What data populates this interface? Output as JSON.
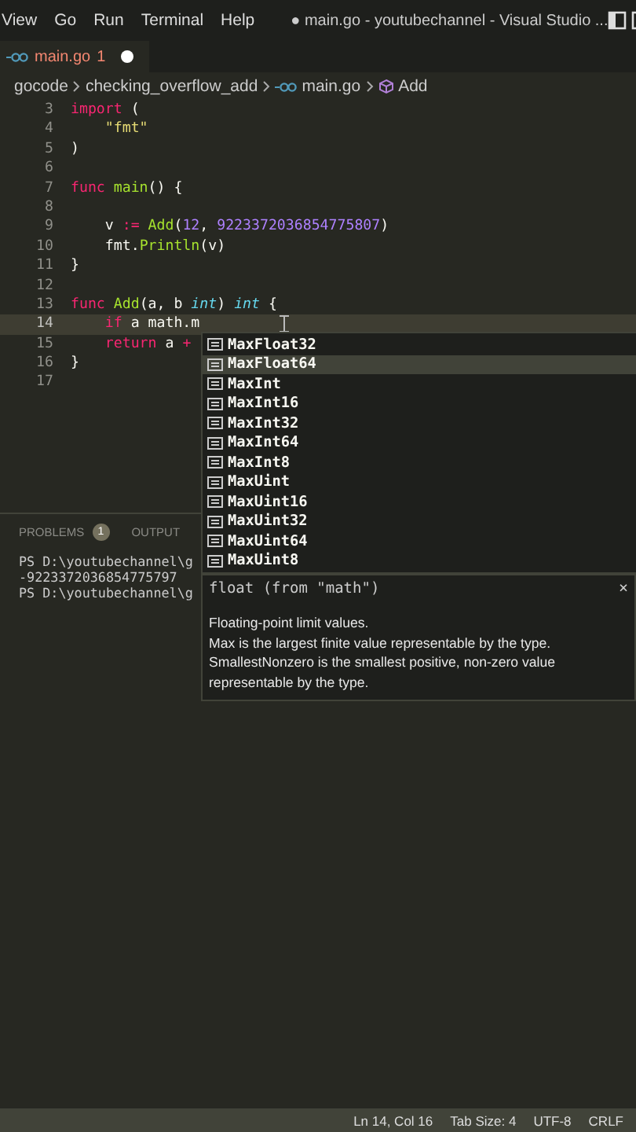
{
  "menu": [
    "View",
    "Go",
    "Run",
    "Terminal",
    "Help"
  ],
  "window": {
    "title": "● main.go - youtubechannel - Visual Studio ..."
  },
  "tabs": [
    {
      "label": "main.go",
      "problems": "1",
      "dirty": true,
      "selected": true
    }
  ],
  "breadcrumb": [
    {
      "text": "gocode",
      "kind": "folder"
    },
    {
      "text": "checking_overflow_add",
      "kind": "folder"
    },
    {
      "text": "main.go",
      "kind": "gofile"
    },
    {
      "text": "Add",
      "kind": "function"
    }
  ],
  "lines": [
    {
      "number": "3",
      "current": false,
      "tokens": [
        {
          "text": "import",
          "kind": "keyword"
        },
        {
          "text": " (",
          "kind": "paren"
        }
      ]
    },
    {
      "number": "4",
      "current": false,
      "tokens": [
        {
          "text": "    \"fmt\"",
          "kind": "string"
        }
      ]
    },
    {
      "number": "5",
      "current": false,
      "tokens": [
        {
          "text": ")",
          "kind": "paren"
        }
      ]
    },
    {
      "number": "6",
      "current": false
    },
    {
      "number": "7",
      "current": false,
      "tokens": [
        {
          "text": "func",
          "kind": "keyword"
        },
        {
          "text": " main",
          "kind": "function"
        },
        {
          "text": "() {",
          "kind": "paren"
        }
      ]
    },
    {
      "number": "8",
      "current": false
    },
    {
      "number": "9",
      "current": false,
      "tokens": [
        {
          "text": "    v ",
          "kind": "plain"
        },
        {
          "text": ":=",
          "kind": "keyword"
        },
        {
          "text": " Add",
          "kind": "function"
        },
        {
          "text": "(",
          "kind": "paren"
        },
        {
          "text": "12",
          "kind": "number"
        },
        {
          "text": ", ",
          "kind": "plain"
        },
        {
          "text": "9223372036854775807",
          "kind": "number"
        },
        {
          "text": ")",
          "kind": "paren"
        }
      ]
    },
    {
      "number": "10",
      "current": false,
      "tokens": [
        {
          "text": "    fmt.",
          "kind": "plain"
        },
        {
          "text": "Println",
          "kind": "function"
        },
        {
          "text": "(v)",
          "kind": "paren"
        }
      ]
    },
    {
      "number": "11",
      "current": false,
      "tokens": [
        {
          "text": "}",
          "kind": "paren"
        }
      ]
    },
    {
      "number": "12",
      "current": false
    },
    {
      "number": "13",
      "current": false,
      "tokens": [
        {
          "text": "func",
          "kind": "keyword"
        },
        {
          "text": " Add",
          "kind": "function"
        },
        {
          "text": "(a, b ",
          "kind": "plain"
        },
        {
          "text": "int",
          "kind": "type"
        },
        {
          "text": ") ",
          "kind": "plain"
        },
        {
          "text": "int",
          "kind": "type"
        },
        {
          "text": " {",
          "kind": "paren"
        }
      ]
    },
    {
      "number": "14",
      "current": true,
      "tokens": [
        {
          "text": "    if",
          "kind": "keyword"
        },
        {
          "text": " a math.m",
          "kind": "plain"
        }
      ]
    },
    {
      "number": "15",
      "current": false,
      "tokens": [
        {
          "text": "    return",
          "kind": "keyword"
        },
        {
          "text": " a ",
          "kind": "plain"
        },
        {
          "text": "+",
          "kind": "keyword"
        }
      ]
    },
    {
      "number": "16",
      "current": false,
      "tokens": [
        {
          "text": "}",
          "kind": "paren"
        }
      ]
    },
    {
      "number": "17",
      "current": false
    }
  ],
  "panel": {
    "tabs": [
      {
        "label": "PROBLEMS",
        "badge": "1",
        "selected": false
      },
      {
        "label": "OUTPUT",
        "selected": false
      }
    ],
    "terminal_lines": [
      "PS D:\\youtubechannel\\g",
      "-9223372036854775797",
      "PS D:\\youtubechannel\\g"
    ]
  },
  "suggestions": [
    {
      "label": "MaxFloat32",
      "selected": false
    },
    {
      "label": "MaxFloat64",
      "selected": true
    },
    {
      "label": "MaxInt",
      "selected": false
    },
    {
      "label": "MaxInt16",
      "selected": false
    },
    {
      "label": "MaxInt32",
      "selected": false
    },
    {
      "label": "MaxInt64",
      "selected": false
    },
    {
      "label": "MaxInt8",
      "selected": false
    },
    {
      "label": "MaxUint",
      "selected": false
    },
    {
      "label": "MaxUint16",
      "selected": false
    },
    {
      "label": "MaxUint32",
      "selected": false
    },
    {
      "label": "MaxUint64",
      "selected": false
    },
    {
      "label": "MaxUint8",
      "selected": false
    }
  ],
  "details": {
    "signature": "float (from \"math\")",
    "close": "×",
    "doc_lines": [
      "Floating-point limit values.",
      "Max is the largest finite value representable by the type.",
      "SmallestNonzero is the smallest positive, non-zero value",
      "representable by the type."
    ]
  },
  "status_bar": [
    "Ln 14, Col 16",
    "Tab Size: 4",
    "UTF-8",
    "CRLF"
  ]
}
